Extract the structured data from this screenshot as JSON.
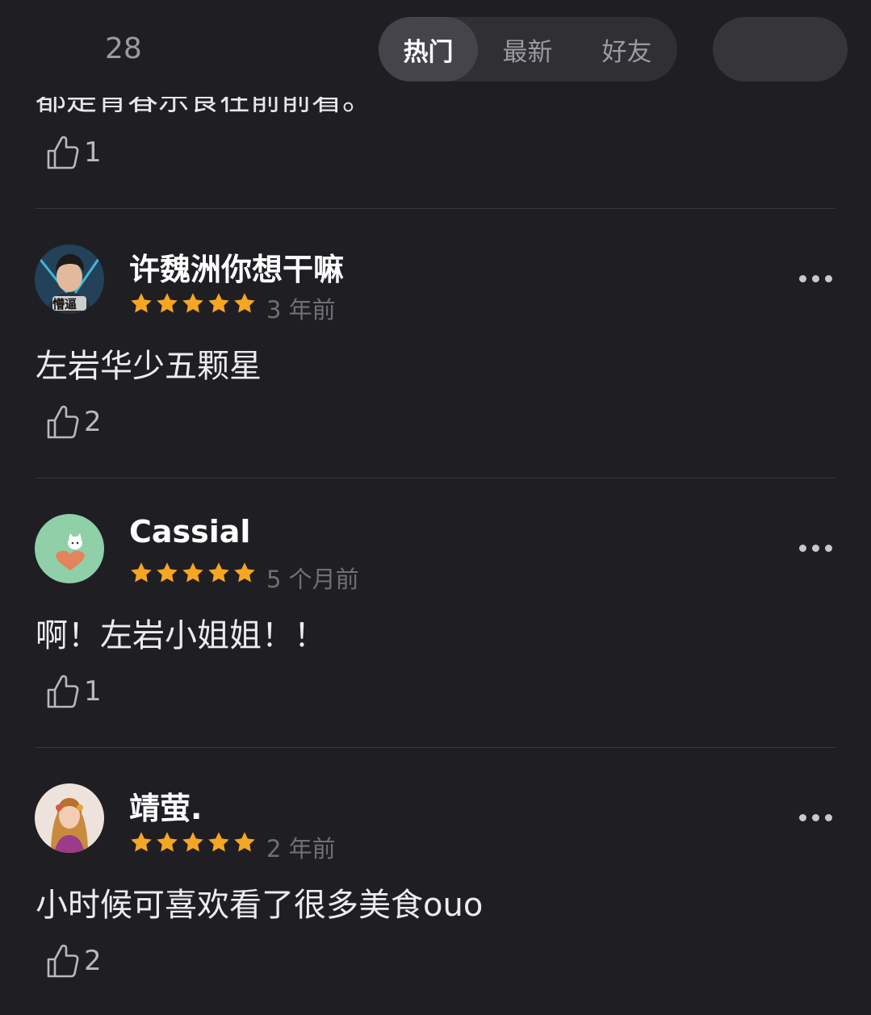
{
  "header": {
    "count": "28",
    "tabs": [
      {
        "label": "热门",
        "active": true
      },
      {
        "label": "最新",
        "active": false
      },
      {
        "label": "好友",
        "active": false
      }
    ]
  },
  "partial_comment": {
    "text": "都是青春乐食在前前看。",
    "likes": "1"
  },
  "comments": [
    {
      "user": "许魏洲你想干嘛",
      "avatar_badge": "懵逼",
      "rating": 5,
      "time": "3 年前",
      "text": "左岩华少五颗星",
      "likes": "2"
    },
    {
      "user": "Cassial",
      "rating": 5,
      "time": "5 个月前",
      "text": "啊！左岩小姐姐！！",
      "likes": "1"
    },
    {
      "user": "靖萤.",
      "rating": 5,
      "time": "2 年前",
      "text": "小时候可喜欢看了很多美食ouo",
      "likes": "2"
    }
  ],
  "colors": {
    "background": "#1f1f23",
    "star": "#f5a623",
    "segment_bg": "#2f2f34",
    "segment_active": "#44444a",
    "divider": "#38383d"
  }
}
